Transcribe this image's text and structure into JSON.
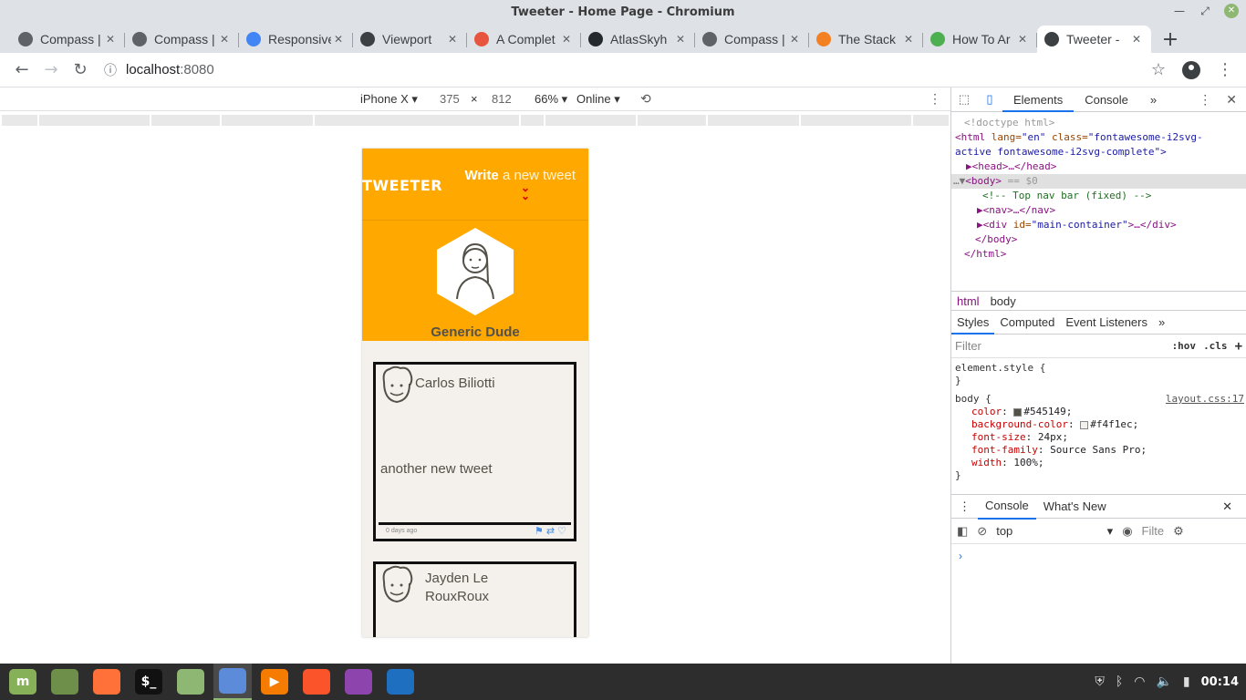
{
  "window": {
    "title": "Tweeter - Home Page - Chromium"
  },
  "tabs": [
    {
      "label": "Compass |",
      "icon": "compass-icon",
      "color": "#5f6368"
    },
    {
      "label": "Compass |",
      "icon": "compass-icon",
      "color": "#5f6368"
    },
    {
      "label": "Responsive",
      "icon": "google-icon",
      "color": "#4285f4"
    },
    {
      "label": "Viewport",
      "icon": "globe-icon",
      "color": "#3c4043"
    },
    {
      "label": "A Complet",
      "icon": "csstricks-icon",
      "color": "#e8553e"
    },
    {
      "label": "AtlasSkyh",
      "icon": "github-icon",
      "color": "#24292e"
    },
    {
      "label": "Compass |",
      "icon": "compass-icon",
      "color": "#5f6368"
    },
    {
      "label": "The Stack",
      "icon": "stackoverflow-icon",
      "color": "#f48024"
    },
    {
      "label": "How To Ar",
      "icon": "webpage-icon",
      "color": "#4caf50"
    },
    {
      "label": "Tweeter -",
      "icon": "globe-icon",
      "color": "#3c4043",
      "active": true
    }
  ],
  "toolbar": {
    "url_host": "localhost",
    "url_port": ":8080"
  },
  "device": {
    "name": "iPhone X ▾",
    "width": "375",
    "times": "×",
    "height": "812",
    "zoom": "66% ▾",
    "network": "Online ▾"
  },
  "app": {
    "brand": "TWEETER",
    "compose_bold": "Write",
    "compose_rest": " a new tweet",
    "compose_icon": "»",
    "profile_name": "Generic Dude",
    "tweets": [
      {
        "author": "Carlos Biliotti",
        "content": "another new tweet",
        "ago": "0 days ago"
      },
      {
        "author": "Jayden Le RouxRoux",
        "content": "",
        "ago": ""
      }
    ]
  },
  "devtools": {
    "tabs": [
      "Elements",
      "Console",
      "»"
    ],
    "dom": {
      "doctype": "<!doctype html>",
      "html_open": "<html",
      "lang_attr": " lang=",
      "lang_val": "\"en\"",
      "class_attr": " class=",
      "class_val": "\"fontawesome-i2svg-",
      "class_val2": "active fontawesome-i2svg-complete\">",
      "head": "▶<head>…</head>",
      "body": "<body>",
      "body_eq": " == $0",
      "comment": "<!-- Top nav bar (fixed) -->",
      "nav": "▶<nav>…</nav>",
      "div_open": "▶<div",
      "div_id_attr": " id=",
      "div_id_val": "\"main-container\"",
      "div_close": ">…</div>",
      "body_close": "</body>",
      "html_close": "</html>"
    },
    "crumbs": [
      "html",
      "body"
    ],
    "subtabs": [
      "Styles",
      "Computed",
      "Event Listeners",
      "»"
    ],
    "filter_placeholder": "Filter",
    "hov": ":hov",
    "cls": ".cls",
    "element_style": "element.style {",
    "brace_close": "}",
    "rule_selector": "body {",
    "rule_source": "layout.css:17",
    "props": [
      {
        "name": "color",
        "value": "#545149;",
        "swatch": "#545149"
      },
      {
        "name": "background-color",
        "value": "#f4f1ec;",
        "swatch": "#f4f1ec"
      },
      {
        "name": "font-size",
        "value": "24px;"
      },
      {
        "name": "font-family",
        "value": "Source Sans Pro;"
      },
      {
        "name": "width",
        "value": "100%;"
      }
    ],
    "drawer_tabs": [
      "Console",
      "What's New"
    ],
    "context": "top",
    "console_filter": "Filte",
    "prompt": "›"
  },
  "taskbar": {
    "apps": [
      {
        "name": "mint-menu-icon",
        "color": "#87b158",
        "glyph": "m"
      },
      {
        "name": "files-icon",
        "color": "#6e8f4a",
        "glyph": ""
      },
      {
        "name": "firefox-icon",
        "color": "#ff7139",
        "glyph": ""
      },
      {
        "name": "terminal-icon",
        "color": "#111111",
        "glyph": "$_"
      },
      {
        "name": "folder-icon",
        "color": "#8fb774",
        "glyph": ""
      },
      {
        "name": "chromium-icon",
        "color": "#5b8bd9",
        "glyph": "",
        "active": true
      },
      {
        "name": "media-player-icon",
        "color": "#f57c00",
        "glyph": "▶"
      },
      {
        "name": "brave-icon",
        "color": "#fb542b",
        "glyph": ""
      },
      {
        "name": "podcasts-icon",
        "color": "#8e44ad",
        "glyph": ""
      },
      {
        "name": "vscode-icon",
        "color": "#1e6fc0",
        "glyph": ""
      }
    ],
    "clock": "00:14"
  }
}
